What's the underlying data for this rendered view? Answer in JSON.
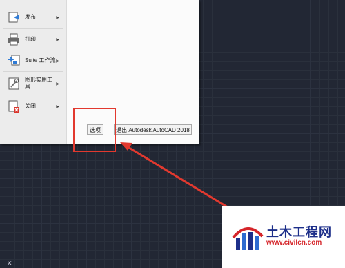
{
  "menu": {
    "items": [
      {
        "label": "发布",
        "icon": "publish-icon",
        "has_submenu": true
      },
      {
        "label": "打印",
        "icon": "print-icon",
        "has_submenu": true
      },
      {
        "label": "Suite 工作流",
        "icon": "suite-workflow-icon",
        "has_submenu": true
      },
      {
        "label": "图形实用工具",
        "icon": "drawing-utilities-icon",
        "has_submenu": true
      },
      {
        "label": "关闭",
        "icon": "close-document-icon",
        "has_submenu": true
      }
    ]
  },
  "buttons": {
    "options_label": "选项",
    "exit_label": "退出 Autodesk AutoCAD 2018"
  },
  "annotation": {
    "highlight_color": "#e2392f"
  },
  "watermark": {
    "title": "土木工程网",
    "url": "www.civilcn.com"
  },
  "colors": {
    "canvas": "#222734",
    "panel": "#f6f6f6",
    "brand_blue": "#1d2f8a",
    "brand_red": "#d5252a"
  }
}
